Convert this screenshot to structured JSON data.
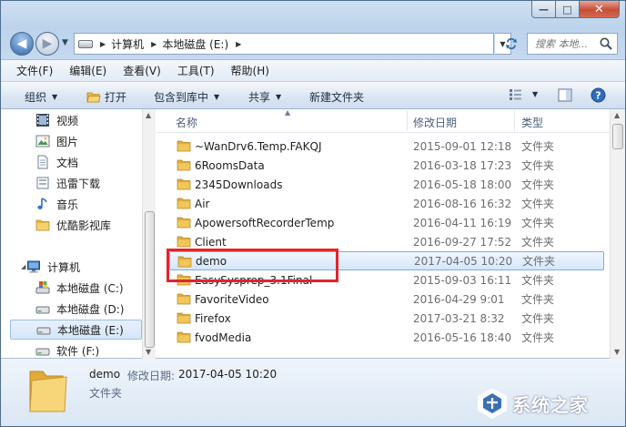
{
  "window": {
    "caption": {
      "minimize": "—",
      "maximize": "□",
      "close": "✕"
    }
  },
  "nav": {
    "back_icon": "back-arrow-icon",
    "forward_icon": "forward-arrow-icon",
    "breadcrumb": [
      "计算机",
      "本地磁盘 (E:)"
    ],
    "search_placeholder": "搜索 本地...",
    "refresh_icon": "refresh-icon"
  },
  "menu": [
    "文件(F)",
    "编辑(E)",
    "查看(V)",
    "工具(T)",
    "帮助(H)"
  ],
  "commands": {
    "organize": "组织",
    "open": "打开",
    "include_library": "包含到库中",
    "share": "共享",
    "new_folder": "新建文件夹"
  },
  "sidebar": {
    "libraries": [
      {
        "label": "视频",
        "icon": "video-icon"
      },
      {
        "label": "图片",
        "icon": "pictures-icon"
      },
      {
        "label": "文档",
        "icon": "documents-icon"
      },
      {
        "label": "迅雷下载",
        "icon": "folder-icon"
      },
      {
        "label": "音乐",
        "icon": "music-icon"
      },
      {
        "label": "优酷影视库",
        "icon": "folder-icon"
      }
    ],
    "computer": {
      "label": "计算机",
      "icon": "computer-icon"
    },
    "drives": [
      {
        "label": "本地磁盘 (C:)",
        "icon": "system-drive-icon"
      },
      {
        "label": "本地磁盘 (D:)",
        "icon": "drive-icon"
      },
      {
        "label": "本地磁盘 (E:)",
        "icon": "drive-icon",
        "selected": true
      },
      {
        "label": "软件 (F:)",
        "icon": "drive-icon"
      }
    ]
  },
  "columns": {
    "name": "名称",
    "date": "修改日期",
    "type": "类型"
  },
  "files": [
    {
      "name": "~WanDrv6.Temp.FAKQJ",
      "date": "2015-09-01 12:18",
      "type": "文件夹"
    },
    {
      "name": "6RoomsData",
      "date": "2016-03-18 17:23",
      "type": "文件夹"
    },
    {
      "name": "2345Downloads",
      "date": "2016-05-18 18:00",
      "type": "文件夹"
    },
    {
      "name": "Air",
      "date": "2016-08-16 16:32",
      "type": "文件夹"
    },
    {
      "name": "ApowersoftRecorderTemp",
      "date": "2016-04-11 16:19",
      "type": "文件夹"
    },
    {
      "name": "Client",
      "date": "2016-09-27 17:52",
      "type": "文件夹"
    },
    {
      "name": "demo",
      "date": "2017-04-05 10:20",
      "type": "文件夹",
      "selected": true
    },
    {
      "name": "EasySysprep_3.1Final",
      "date": "2015-09-03 16:11",
      "type": "文件夹"
    },
    {
      "name": "FavoriteVideo",
      "date": "2016-04-29 9:01",
      "type": "文件夹"
    },
    {
      "name": "Firefox",
      "date": "2017-03-21 8:32",
      "type": "文件夹"
    },
    {
      "name": "fvodMedia",
      "date": "2016-05-16 18:40",
      "type": "文件夹"
    }
  ],
  "details": {
    "name": "demo",
    "modified_label": "修改日期:",
    "modified_value": "2017-04-05 10:20",
    "type": "文件夹"
  },
  "watermark": {
    "text": "系统之家"
  },
  "colors": {
    "selection_border": "#84acdd",
    "highlight_box": "#e2252b",
    "folder_yellow": "#f2c75a"
  }
}
